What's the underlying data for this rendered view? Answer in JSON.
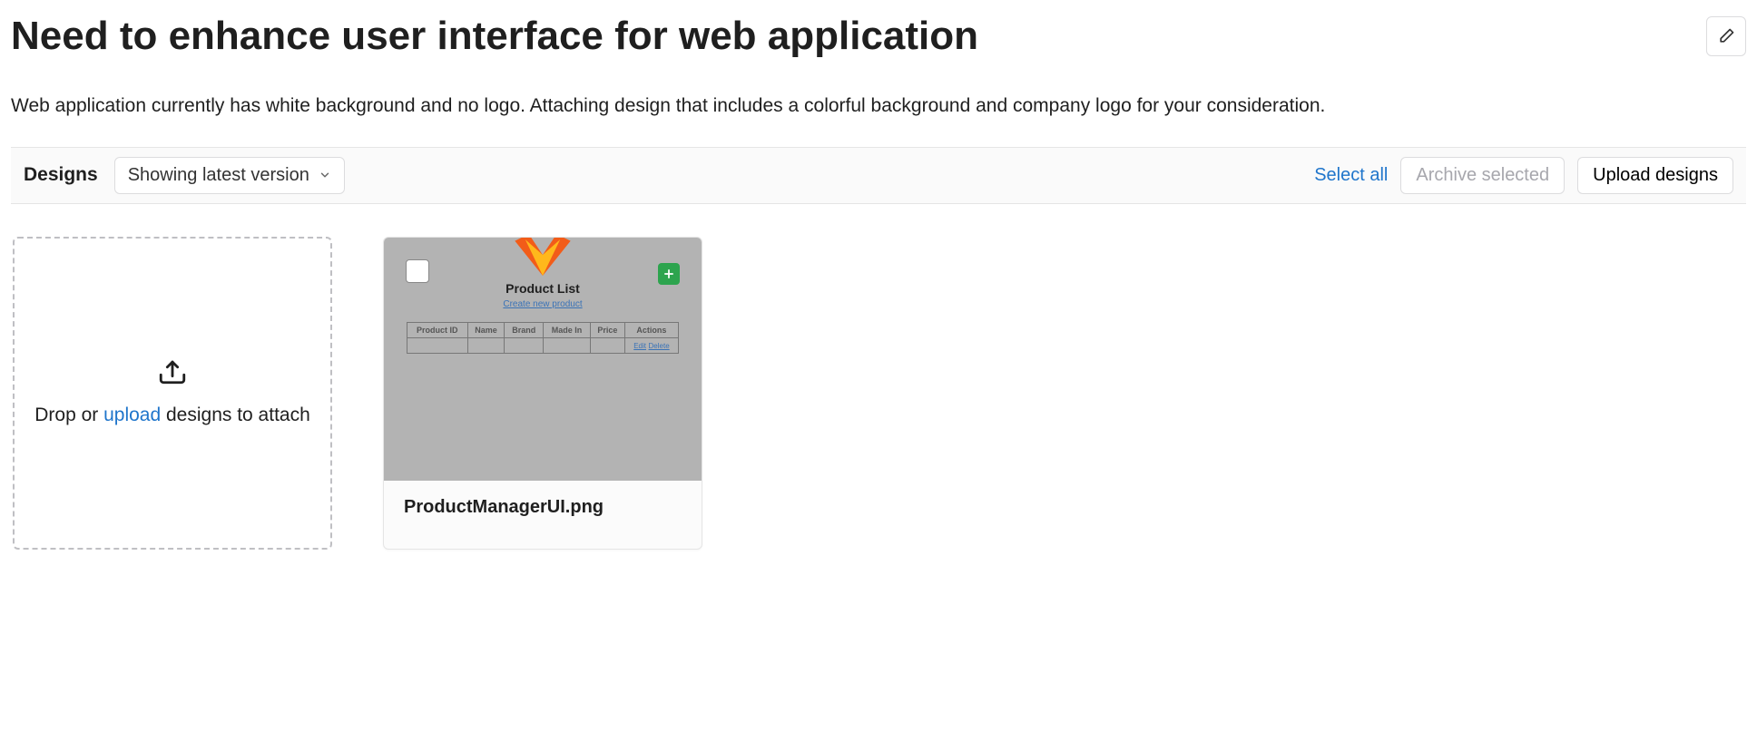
{
  "issue": {
    "title": "Need to enhance user interface for web application",
    "description": "Web application currently has white background and no logo. Attaching design that includes a colorful background and company logo for your consideration."
  },
  "designs_bar": {
    "label": "Designs",
    "version_label": "Showing latest version",
    "select_all": "Select all",
    "archive_selected": "Archive selected",
    "upload_designs": "Upload designs"
  },
  "dropzone": {
    "prefix": "Drop or ",
    "upload": "upload",
    "suffix": " designs to attach"
  },
  "design_card": {
    "thumb_title": "Product List",
    "thumb_link": "Create new product",
    "table_headers": [
      "Product ID",
      "Name",
      "Brand",
      "Made In",
      "Price",
      "Actions"
    ],
    "row_action_edit": "Edit",
    "row_action_delete": "Delete",
    "filename": "ProductManagerUI.png"
  }
}
